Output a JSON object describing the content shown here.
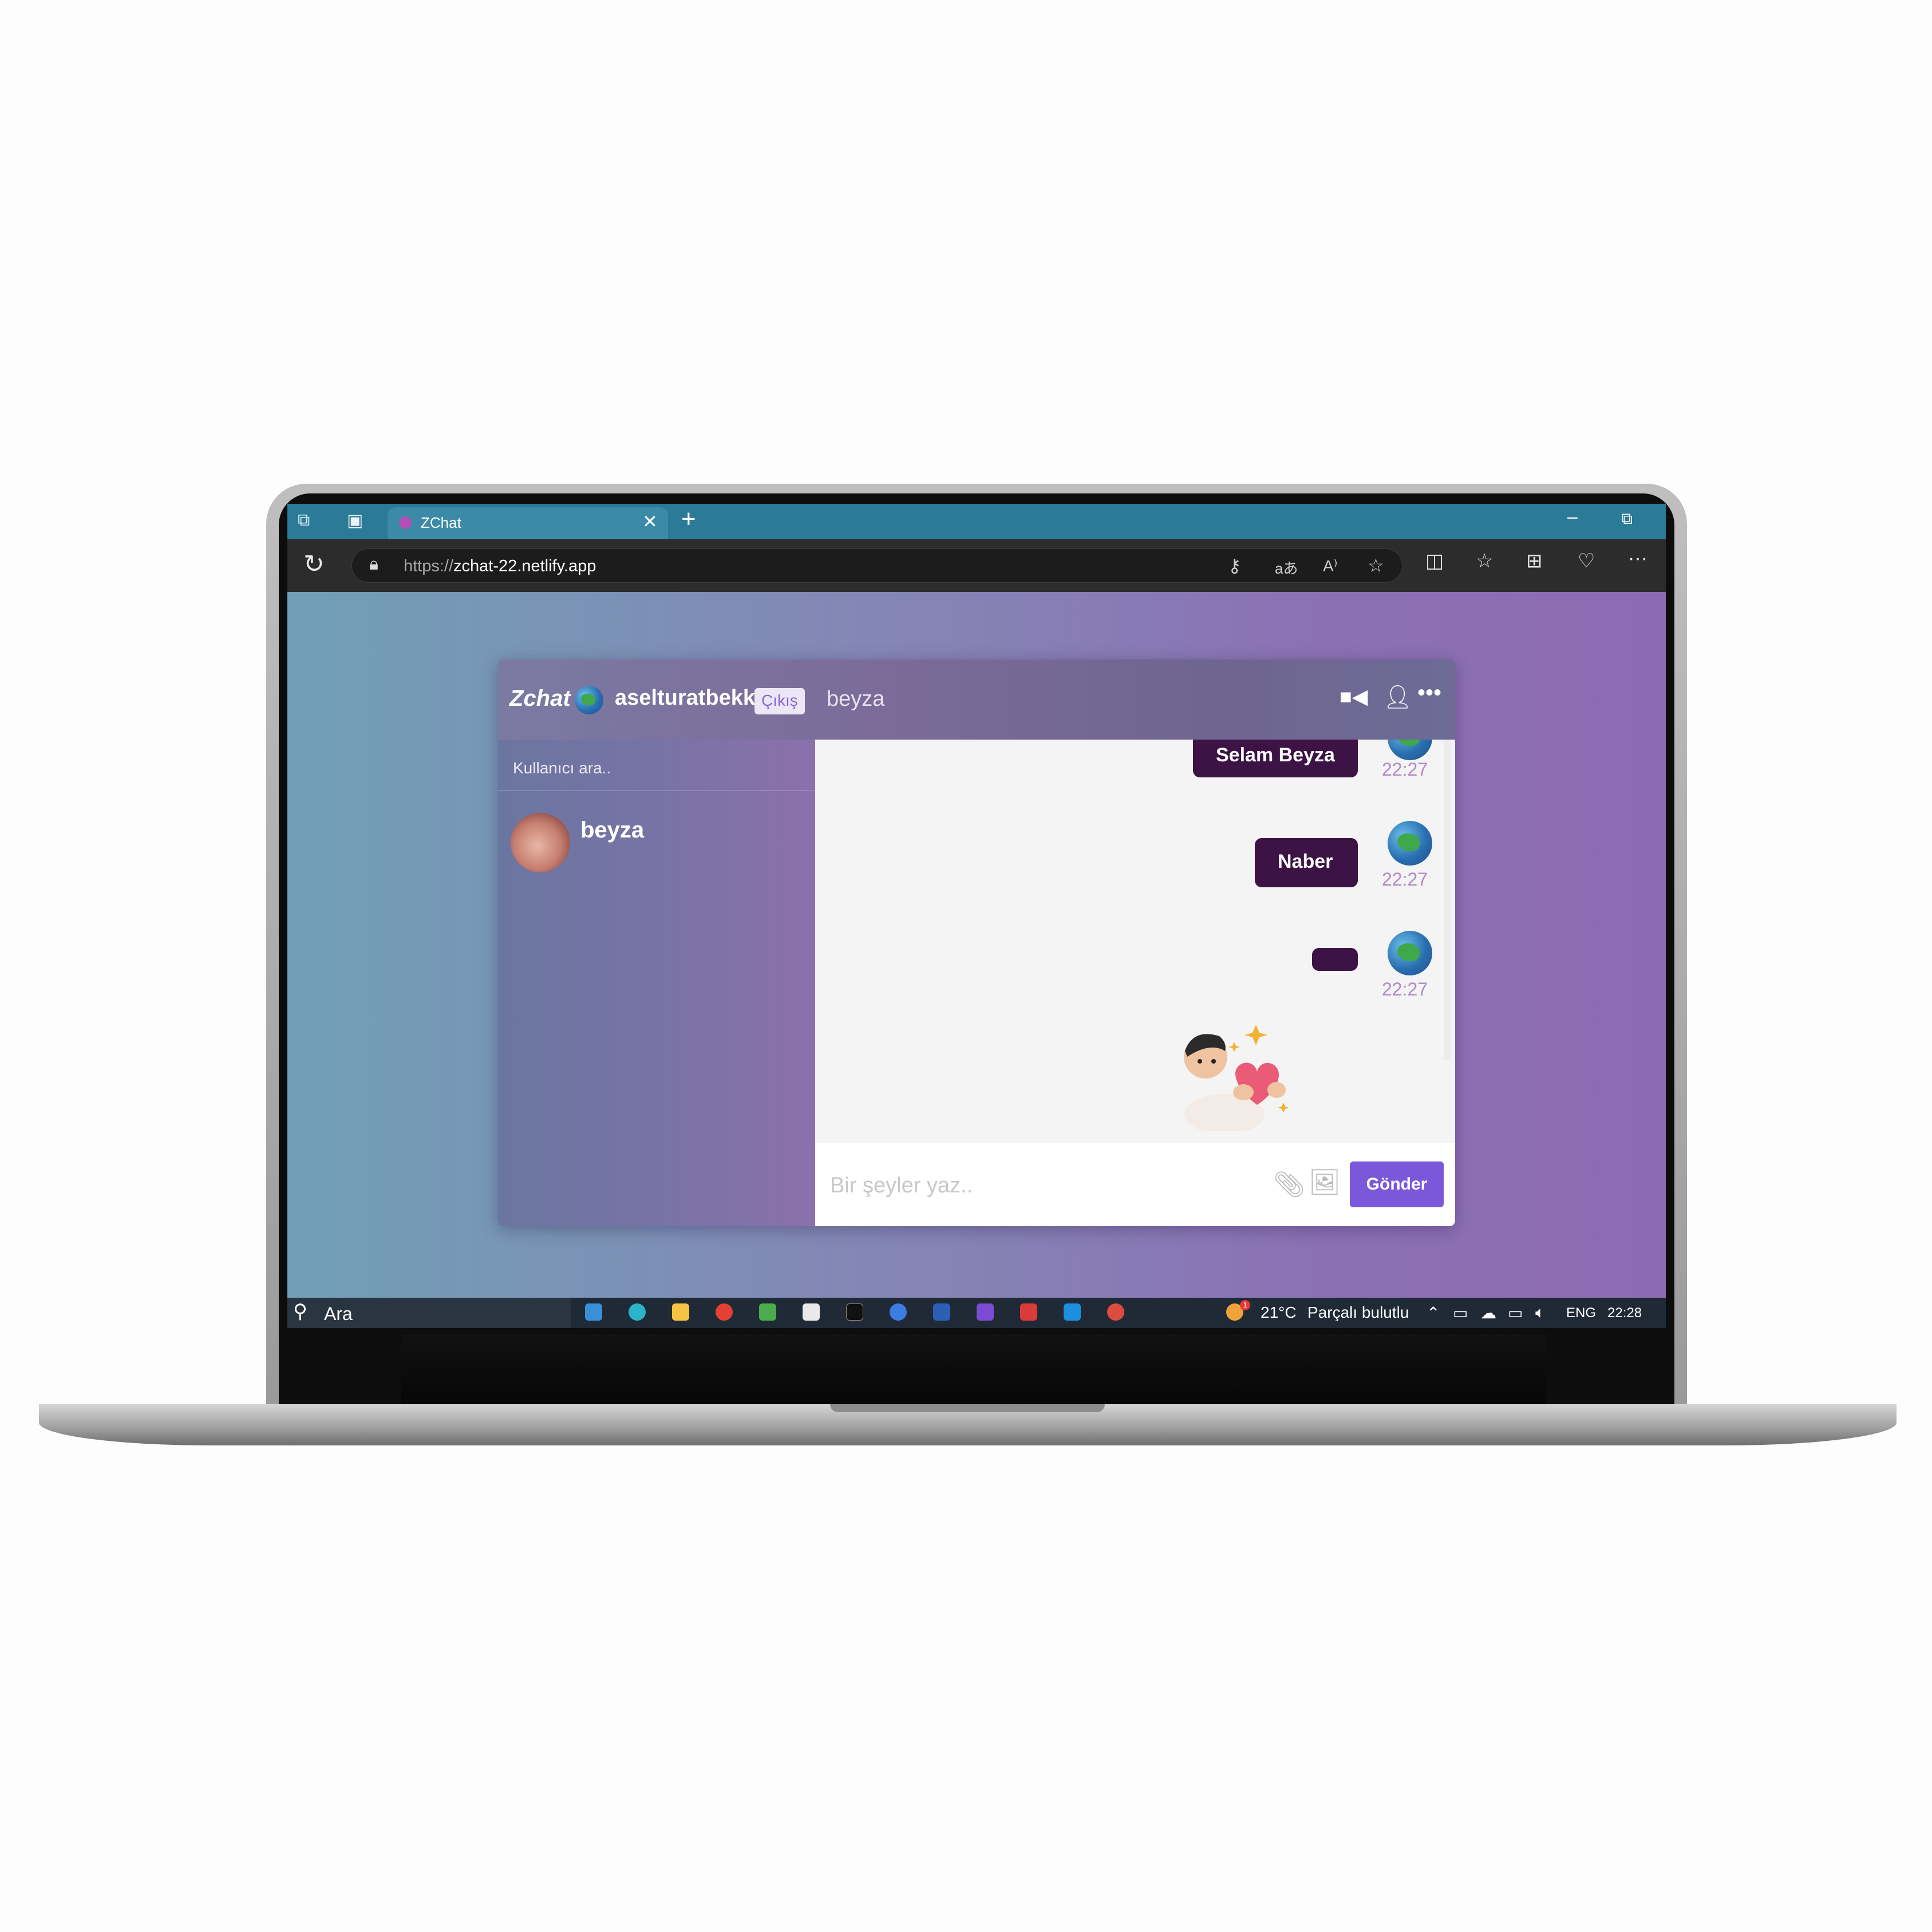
{
  "browser": {
    "tab_title": "ZChat",
    "tab_close": "✕",
    "new_tab": "+",
    "minimize": "–",
    "restore": "⧉",
    "url_protocol": "https://",
    "url_host": "zchat-22.netlify.app",
    "more": "···"
  },
  "app": {
    "brand": "Zchat",
    "current_user": "aselturatbekk",
    "logout_label": "Çıkış",
    "chat_with": "beyza",
    "more_icon": "•••",
    "search_placeholder": "Kullanıcı ara..",
    "contacts": [
      {
        "name": "beyza"
      }
    ],
    "messages": [
      {
        "text": "Selam Beyza",
        "time": "22:27"
      },
      {
        "text": "Naber",
        "time": "22:27"
      },
      {
        "text": "",
        "time": "22:27"
      }
    ],
    "sticker": "person-holding-heart-sticker",
    "input_placeholder": "Bir şeyler yaz..",
    "send_label": "Gönder"
  },
  "taskbar": {
    "search_label": "Ara",
    "weather": "21°C",
    "weather_desc": "Parçalı bulutlu",
    "weather_badge": "1",
    "language": "ENG",
    "clock": "22:28"
  },
  "colors": {
    "accent": "#7b58da",
    "bubble": "#3d1346",
    "time": "#b08ac6",
    "tabbar": "#2a7a98"
  }
}
